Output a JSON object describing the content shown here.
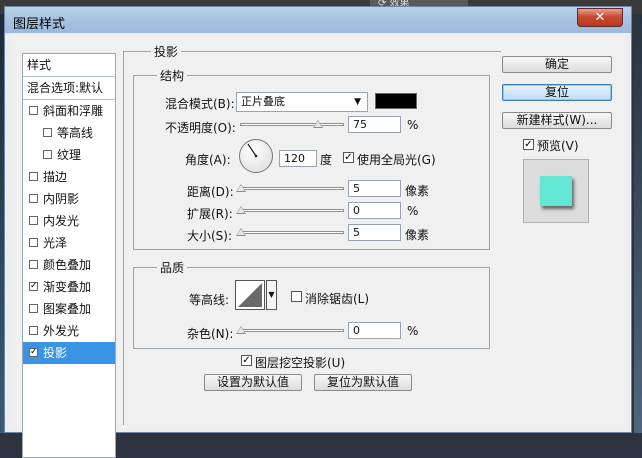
{
  "background": {
    "panel_tab_label": "效果"
  },
  "dialog": {
    "title": "图层样式",
    "close_label": "✕"
  },
  "style_list": {
    "header": "样式",
    "blend_options": "混合选项:默认",
    "items": [
      {
        "label": "斜面和浮雕",
        "checked": false,
        "indent": 0
      },
      {
        "label": "等高线",
        "checked": false,
        "indent": 1
      },
      {
        "label": "纹理",
        "checked": false,
        "indent": 1
      },
      {
        "label": "描边",
        "checked": false,
        "indent": 0
      },
      {
        "label": "内阴影",
        "checked": false,
        "indent": 0
      },
      {
        "label": "内发光",
        "checked": false,
        "indent": 0
      },
      {
        "label": "光泽",
        "checked": false,
        "indent": 0
      },
      {
        "label": "颜色叠加",
        "checked": false,
        "indent": 0
      },
      {
        "label": "渐变叠加",
        "checked": true,
        "indent": 0
      },
      {
        "label": "图案叠加",
        "checked": false,
        "indent": 0
      },
      {
        "label": "外发光",
        "checked": false,
        "indent": 0
      },
      {
        "label": "投影",
        "checked": true,
        "indent": 0,
        "selected": true
      }
    ]
  },
  "drop_shadow": {
    "section_title": "投影",
    "structure": {
      "title": "结构",
      "blend_mode_label": "混合模式(B):",
      "blend_mode_value": "正片叠底",
      "shadow_color": "#000000",
      "opacity_label": "不透明度(O):",
      "opacity_value": "75",
      "opacity_unit": "%",
      "angle_label": "角度(A):",
      "angle_value": "120",
      "angle_unit": "度",
      "global_light_label": "使用全局光(G)",
      "global_light_checked": true,
      "distance_label": "距离(D):",
      "distance_value": "5",
      "distance_unit": "像素",
      "spread_label": "扩展(R):",
      "spread_value": "0",
      "spread_unit": "%",
      "size_label": "大小(S):",
      "size_value": "5",
      "size_unit": "像素"
    },
    "quality": {
      "title": "品质",
      "contour_label": "等高线:",
      "anti_alias_label": "消除锯齿(L)",
      "anti_alias_checked": false,
      "noise_label": "杂色(N):",
      "noise_value": "0",
      "noise_unit": "%"
    },
    "knockout_label": "图层挖空投影(U)",
    "knockout_checked": true,
    "make_default_label": "设置为默认值",
    "reset_default_label": "复位为默认值"
  },
  "right_buttons": {
    "ok": "确定",
    "reset": "复位",
    "new_style": "新建样式(W)...",
    "preview_label": "预览(V)",
    "preview_checked": true,
    "preview_swatch_color": "#63e6d4"
  }
}
